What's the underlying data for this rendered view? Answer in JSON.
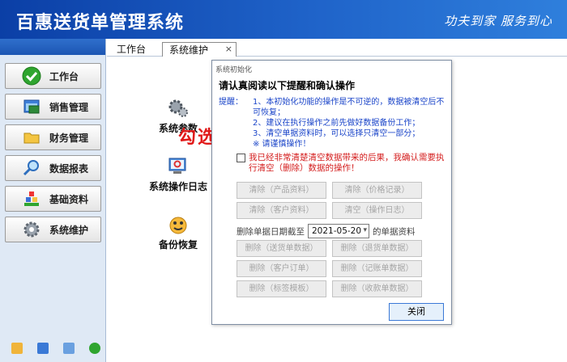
{
  "header": {
    "title": "百惠送货单管理系统",
    "slogan": "功夫到家 服务到心"
  },
  "sidebar": {
    "items": [
      {
        "label": "工作台",
        "icon": "checkmark-icon"
      },
      {
        "label": "销售管理",
        "icon": "window-icon"
      },
      {
        "label": "财务管理",
        "icon": "folder-icon"
      },
      {
        "label": "数据报表",
        "icon": "magnifier-icon"
      },
      {
        "label": "基础资料",
        "icon": "blocks-icon"
      },
      {
        "label": "系统维护",
        "icon": "gear-icon"
      }
    ]
  },
  "tabs": {
    "workbench": "工作台",
    "maintenance": "系统维护",
    "close": "×"
  },
  "tools": {
    "params": "系统参数",
    "log": "系统操作日志",
    "backup": "备份恢复"
  },
  "annotation": "勾选确认",
  "dialog": {
    "title": "系统初始化",
    "heading": "请认真阅读以下提醒和确认操作",
    "tips_label": "提醒：",
    "tips": [
      "1、本初始化功能的操作是不可逆的，数据被清空后不可恢复；",
      "2、建议在执行操作之前先做好数据备份工作；",
      "3、清空单据资料时，可以选择只清空一部分；",
      "※ 请谨慎操作！"
    ],
    "confirm_text": "我已经非常清楚清空数据带来的后果，我确认需要执行清空（删除）数据的操作！",
    "clear_buttons": [
      "清除（产品资料）",
      "清除（价格记录）",
      "清除（客户资料）",
      "清空（操作日志）"
    ],
    "date_prefix": "删除单据日期截至",
    "date_value": "2021-05-20",
    "date_suffix": "的单据资料",
    "delete_buttons": [
      "删除（送货单数据）",
      "删除（退货单数据）",
      "删除（客户订单）",
      "删除（记账单数据）",
      "删除（标签模板）",
      "删除（收款单数据）"
    ],
    "close_label": "关闭"
  }
}
